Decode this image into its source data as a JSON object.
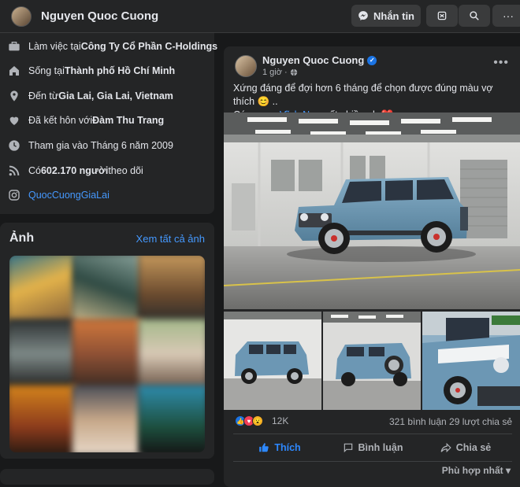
{
  "header": {
    "name": "Nguyen Quoc Cuong",
    "message_label": "Nhắn tin"
  },
  "intro": [
    {
      "icon": "briefcase-icon",
      "prefix": "Làm việc tại ",
      "bold": "Công Ty Cổ Phần C-Holdings"
    },
    {
      "icon": "home-icon",
      "prefix": "Sống tại ",
      "bold": "Thành phố Hồ Chí Minh"
    },
    {
      "icon": "location-pin-icon",
      "prefix": "Đến từ ",
      "bold": "Gia Lai, Gia Lai, Vietnam"
    },
    {
      "icon": "heart-icon",
      "prefix": "Đã kết hôn với ",
      "bold": "Đàm Thu Trang"
    },
    {
      "icon": "clock-icon",
      "prefix": "Tham gia vào Tháng 6 năm 2009",
      "bold": ""
    },
    {
      "icon": "rss-icon",
      "prefix": "Có ",
      "bold": "602.170 người",
      "suffix": " theo dõi"
    },
    {
      "icon": "instagram-icon",
      "link": "QuocCuongGiaLai"
    }
  ],
  "photos": {
    "title": "Ảnh",
    "see_all": "Xem tất cả ảnh"
  },
  "post": {
    "author": "Nguyen Quoc Cuong",
    "time": "1 giờ ·",
    "caption_line1": "Xứng đáng để đợi hơn 6 tháng để chọn được đúng màu vợ thích 😊 ..",
    "caption_pre": "Cám ơn a ",
    "caption_mention": "Vĩnh Nam",
    "caption_post": " rất nhiều ạh ❤️",
    "reaction_count": "12K",
    "comments": "321 bình luận",
    "shares": "29 lượt chia sẻ",
    "like_label": "Thích",
    "comment_label": "Bình luận",
    "share_label": "Chia sẻ",
    "sort_label": "Phù hợp nhất"
  },
  "colors": {
    "background": "#18191a",
    "card": "#242526",
    "link": "#4599ff",
    "like_blue": "#2d88ff",
    "car_blue": "#6c97b4"
  }
}
